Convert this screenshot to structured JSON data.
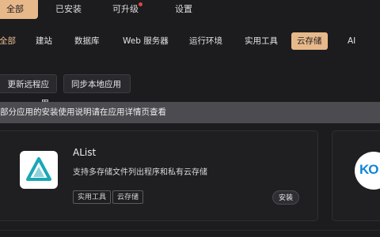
{
  "top_tabs": [
    {
      "label": "全部",
      "active": true
    },
    {
      "label": "已安装"
    },
    {
      "label": "可升级",
      "has_badge": true
    },
    {
      "label": "设置"
    }
  ],
  "categories": [
    "全部",
    "建站",
    "数据库",
    "Web 服务器",
    "运行环境",
    "实用工具",
    "云存储",
    "AI"
  ],
  "active_category": "云存储",
  "actions": {
    "update_remote": "更新远程应用",
    "sync_local": "同步本地应用"
  },
  "notice": "部分应用的安装使用说明请在应用详情页查看",
  "apps": [
    {
      "name": "AList",
      "description": "支持多存储文件列出程序和私有云存储",
      "tags": [
        "实用工具",
        "云存储"
      ],
      "install_label": "安装",
      "icon": "alist-logo"
    },
    {
      "partial_logo_text": "KO",
      "icon": "koodo-logo"
    }
  ],
  "colors": {
    "accent": "#e7b98a",
    "background": "#1c1c1f",
    "notice_bg": "#4b4b50",
    "badge": "#e0453b"
  }
}
